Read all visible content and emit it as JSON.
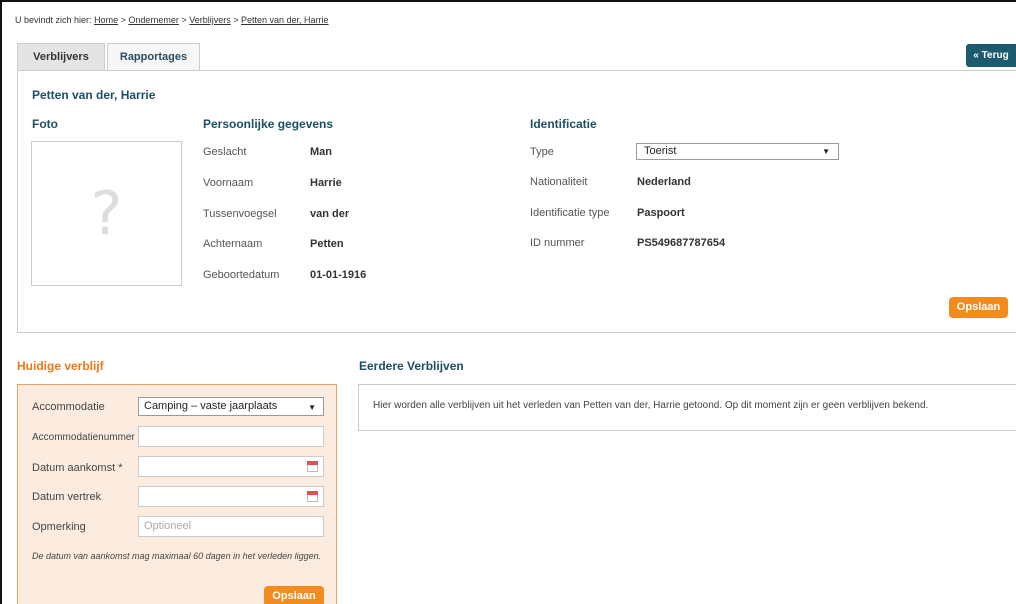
{
  "breadcrumb": {
    "prefix": "U bevindt zich hier:",
    "items": [
      "Home",
      "Ondernemer",
      "Verblijvers",
      "Petten van der, Harrie"
    ],
    "separator": ">"
  },
  "tabs": [
    {
      "label": "Verblijvers",
      "active": true
    },
    {
      "label": "Rapportages",
      "active": false
    }
  ],
  "back_label": "« Terug",
  "person": {
    "name": "Petten van der, Harrie",
    "photo": {
      "title": "Foto",
      "placeholder": "?"
    },
    "personal": {
      "title": "Persoonlijke gegevens",
      "fields": [
        {
          "label": "Geslacht",
          "value": "Man"
        },
        {
          "label": "Voornaam",
          "value": "Harrie"
        },
        {
          "label": "Tussenvoegsel",
          "value": "van der"
        },
        {
          "label": "Achternaam",
          "value": "Petten"
        },
        {
          "label": "Geboortedatum",
          "value": "01-01-1916"
        }
      ]
    },
    "identification": {
      "title": "Identificatie",
      "type_label": "Type",
      "type_value": "Toerist",
      "fields": [
        {
          "label": "Nationaliteit",
          "value": "Nederland"
        },
        {
          "label": "Identificatie type",
          "value": "Paspoort"
        },
        {
          "label": "ID nummer",
          "value": "PS549687787654"
        }
      ]
    },
    "save_label": "Opslaan"
  },
  "current_stay": {
    "title": "Huidige verblijf",
    "accommodatie_label": "Accommodatie",
    "accommodatie_value": "Camping – vaste jaarplaats",
    "accommodatienummer_label": "Accommodatienummer",
    "aankomst_label": "Datum aankomst *",
    "vertrek_label": "Datum vertrek",
    "opmerking_label": "Opmerking",
    "opmerking_placeholder": "Optioneel",
    "note": "De datum van aankomst mag maximaal 60 dagen in het verleden liggen.",
    "save_label": "Opslaan"
  },
  "previous_stays": {
    "title": "Eerdere Verblijven",
    "message": "Hier worden alle verblijven uit het verleden van Petten van der, Harrie getoond. Op dit moment zijn er geen verblijven bekend."
  },
  "colors": {
    "accent_orange": "#f28c1e",
    "heading_blue": "#1d4f62",
    "back_button": "#1c5b6e",
    "current_stay_bg": "#fcecdf"
  }
}
